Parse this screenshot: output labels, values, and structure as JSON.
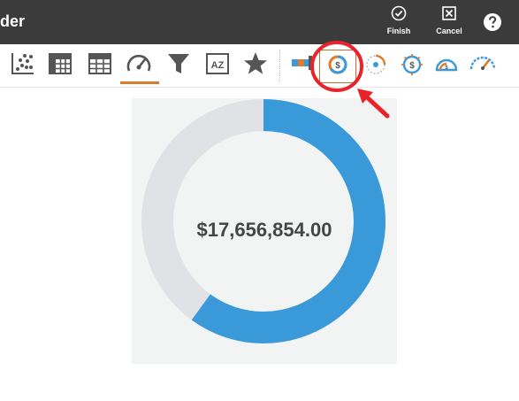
{
  "header": {
    "title": "der",
    "finish_label": "Finish",
    "cancel_label": "Cancel"
  },
  "toolbar": {
    "icons": [
      "scatter-chart-icon",
      "pivot-grid-icon",
      "table-grid-icon",
      "gauge-icon",
      "funnel-icon",
      "az-sort-icon",
      "star-icon",
      "bar-chart-icon",
      "donut-dollar-icon",
      "dial-icon",
      "radial-gauge-icon",
      "semicircle-gauge-icon",
      "speedometer-icon"
    ],
    "az_label": "AZ",
    "selected": "donut-dollar-icon"
  },
  "widget": {
    "value_label": "$17,656,854.00",
    "fill_fraction": 0.6
  },
  "colors": {
    "header_bg": "#3b3b3b",
    "accent": "#e07a2c",
    "donut_fill": "#3a9ad9",
    "donut_track": "#e0e2e5",
    "annotation": "#e8232a"
  }
}
